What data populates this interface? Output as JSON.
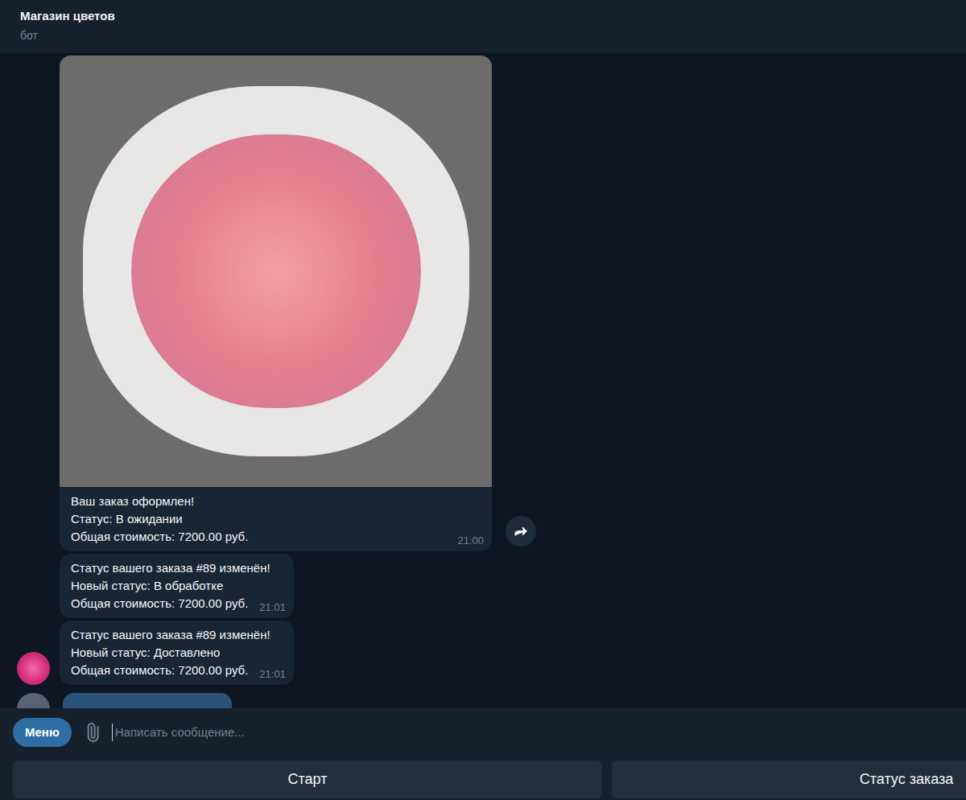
{
  "chat": {
    "title": "Магазин цветов",
    "subtitle": "бот"
  },
  "messages": [
    {
      "kind": "photo",
      "lines": [
        "Ваш заказ оформлен!",
        "Статус: В ожидании",
        "Общая стоимость: 7200.00 руб."
      ],
      "time": "21:00",
      "avatar": false,
      "forward": true
    },
    {
      "kind": "text",
      "lines": [
        "Статус вашего заказа #89 изменён!",
        "Новый статус: В обработке",
        "Общая стоимость: 7200.00 руб."
      ],
      "time": "21:01",
      "avatar": false,
      "forward": false
    },
    {
      "kind": "text",
      "lines": [
        "Статус вашего заказа #89 изменён!",
        "Новый статус: Доставлено",
        "Общая стоимость: 7200.00 руб."
      ],
      "time": "21:01",
      "avatar": true,
      "forward": false
    }
  ],
  "input": {
    "menu_button": "Меню",
    "placeholder": "Написать сообщение..."
  },
  "keyboard": [
    {
      "label": "Старт"
    },
    {
      "label": "Статус заказа"
    }
  ]
}
